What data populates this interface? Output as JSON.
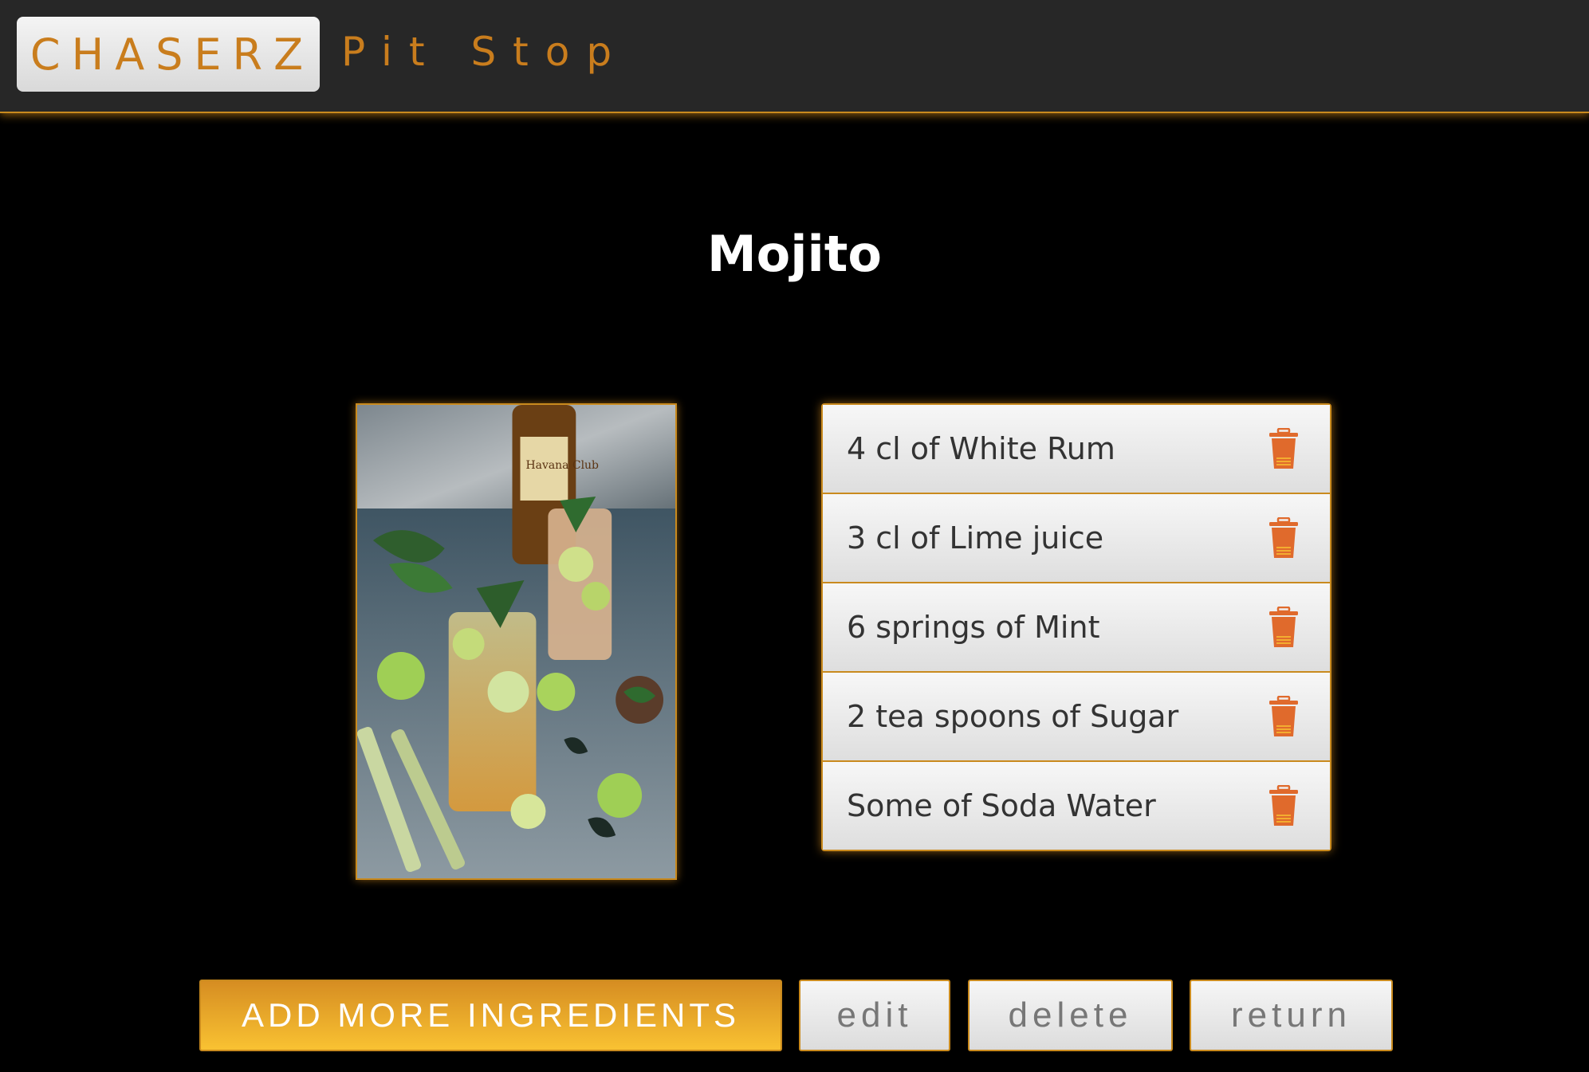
{
  "navbar": {
    "brand": "CHASERZ",
    "subtitle": "Pit Stop"
  },
  "recipe": {
    "title": "Mojito",
    "ingredients": [
      {
        "label": "4 cl of White Rum"
      },
      {
        "label": "3 cl of Lime juice"
      },
      {
        "label": "6 springs of Mint"
      },
      {
        "label": "2 tea spoons of Sugar"
      },
      {
        "label": "Some of Soda Water"
      }
    ],
    "photo_bottle_text": "Havana Club"
  },
  "actions": {
    "add_label": "ADD MORE INGREDIENTS",
    "edit_label": "edit",
    "delete_label": "delete",
    "return_label": "return"
  },
  "colors": {
    "accent": "#c98a1e",
    "navbar_bg": "#272727",
    "page_bg": "#000000",
    "trash_icon": "#e06a2c",
    "primary_button_top": "#d68d22",
    "primary_button_bottom": "#f9c232"
  },
  "icons": {
    "ingredient_action": "trash-icon"
  }
}
